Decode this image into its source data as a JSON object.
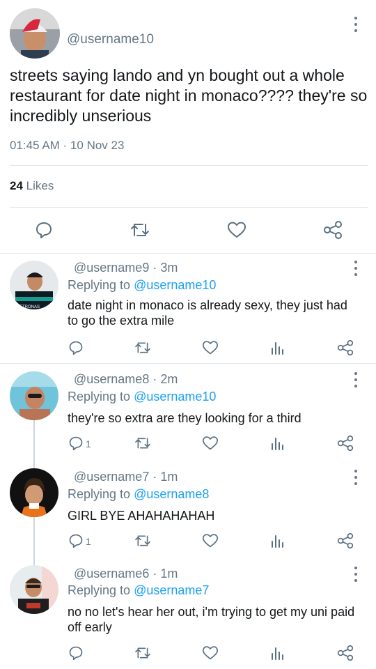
{
  "main_tweet": {
    "handle": "@username10",
    "text": "streets saying lando and yn bought out a whole restaurant for date night in monaco???? they're so incredibly unserious",
    "timestamp": "01:45 AM · 10 Nov 23",
    "likes_count": "24",
    "likes_label": "Likes",
    "actions": [
      "reply-icon",
      "retweet-icon",
      "like-icon",
      "share-icon"
    ]
  },
  "replies": [
    {
      "header": "@username9 · 3m",
      "replying_label": "Replying to",
      "replying_to": "@username10",
      "text": "date night in monaco is already sexy, they just had to go the extra mile",
      "reply_count": "",
      "avatar": "racing-driver-avatar"
    },
    {
      "header": "@username8 · 2m",
      "replying_label": "Replying to",
      "replying_to": "@username10",
      "text": "they're so extra are they looking for a third",
      "reply_count": "1",
      "avatar": "pool-selfie-avatar"
    },
    {
      "header": "@username7 · 1m",
      "replying_label": "Replying to",
      "replying_to": "@username8",
      "text": "GIRL BYE AHAHAHAHAH",
      "reply_count": "1",
      "avatar": "curly-hair-avatar"
    },
    {
      "header": "@username6 · 1m",
      "replying_label": "Replying to",
      "replying_to": "@username7",
      "text": "no no let's hear her out, i'm trying to get my uni paid off early",
      "reply_count": "",
      "avatar": "sunglasses-avatar"
    }
  ],
  "colors": {
    "accent": "#1da1f2",
    "secondary_text": "#657786",
    "divider": "#e1e8ed"
  }
}
